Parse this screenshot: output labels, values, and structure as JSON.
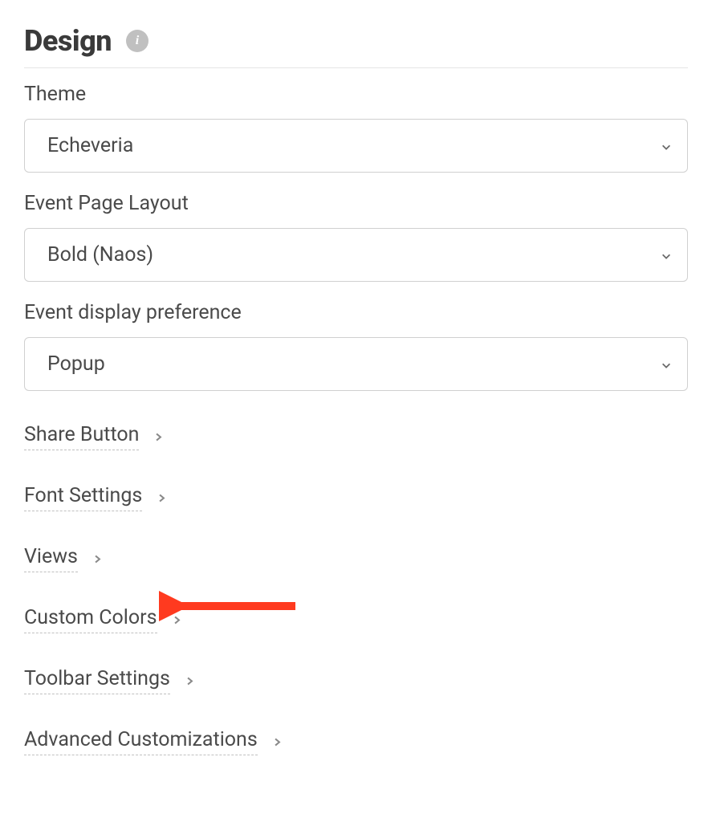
{
  "section": {
    "title": "Design"
  },
  "fields": {
    "theme": {
      "label": "Theme",
      "value": "Echeveria"
    },
    "event_page_layout": {
      "label": "Event Page Layout",
      "value": "Bold (Naos)"
    },
    "event_display_preference": {
      "label": "Event display preference",
      "value": "Popup"
    }
  },
  "links": {
    "share_button": "Share Button",
    "font_settings": "Font Settings",
    "views": "Views",
    "custom_colors": "Custom Colors",
    "toolbar_settings": "Toolbar Settings",
    "advanced_customizations": "Advanced Customizations"
  }
}
